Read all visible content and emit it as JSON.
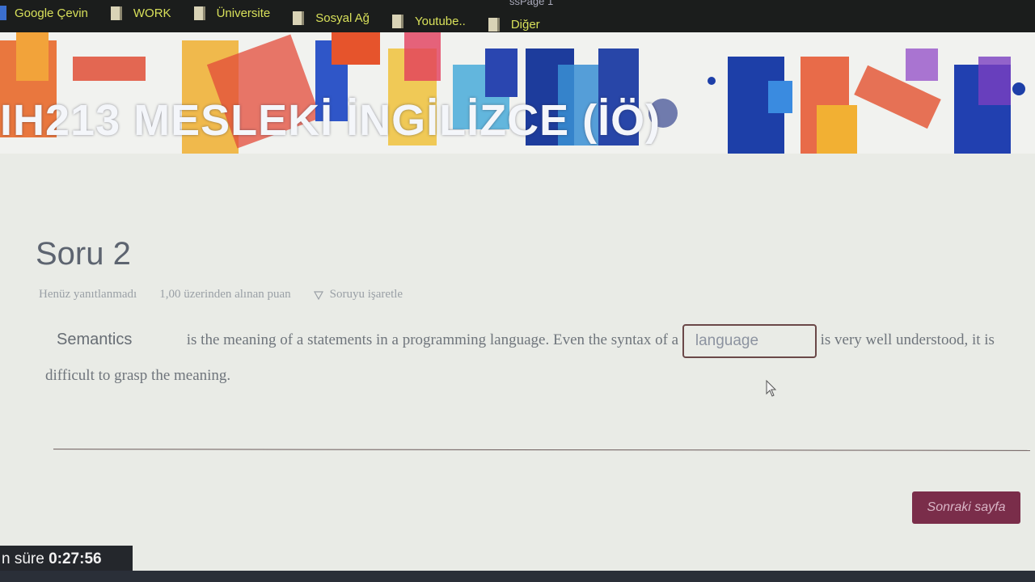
{
  "browser": {
    "tab_title": "ssPage 1",
    "bookmarks": [
      {
        "label": "Google Çevin",
        "icon": "google-translate-icon"
      },
      {
        "label": "WORK",
        "icon": "folder-icon"
      },
      {
        "label": "Üniversite",
        "icon": "folder-icon"
      },
      {
        "label": "Sosyal Ağ",
        "icon": "folder-icon"
      },
      {
        "label": "Youtube..",
        "icon": "folder-icon"
      },
      {
        "label": "Diğer",
        "icon": "folder-icon"
      }
    ]
  },
  "banner": {
    "course_title": "IH213 MESLEKİ İNGİLİZCE (İÖ)"
  },
  "question": {
    "title": "Soru 2",
    "status": "Henüz yanıtlanmadı",
    "points": "1,00 üzerinden alınan puan",
    "flag_label": "Soruyu işaretle",
    "selected_answer": "Semantics",
    "text_part1": "is the meaning of a statements in a programming language. Even the syntax of a",
    "input_value": "language",
    "text_part2": "is very well understood, it is difficult to grasp the meaning."
  },
  "navigation": {
    "next_label": "Sonraki sayfa"
  },
  "timer": {
    "label": "n süre",
    "value": "0:27:56"
  },
  "colors": {
    "accent_button": "#7a2d4a",
    "bookmark_text": "#d8e05a"
  }
}
